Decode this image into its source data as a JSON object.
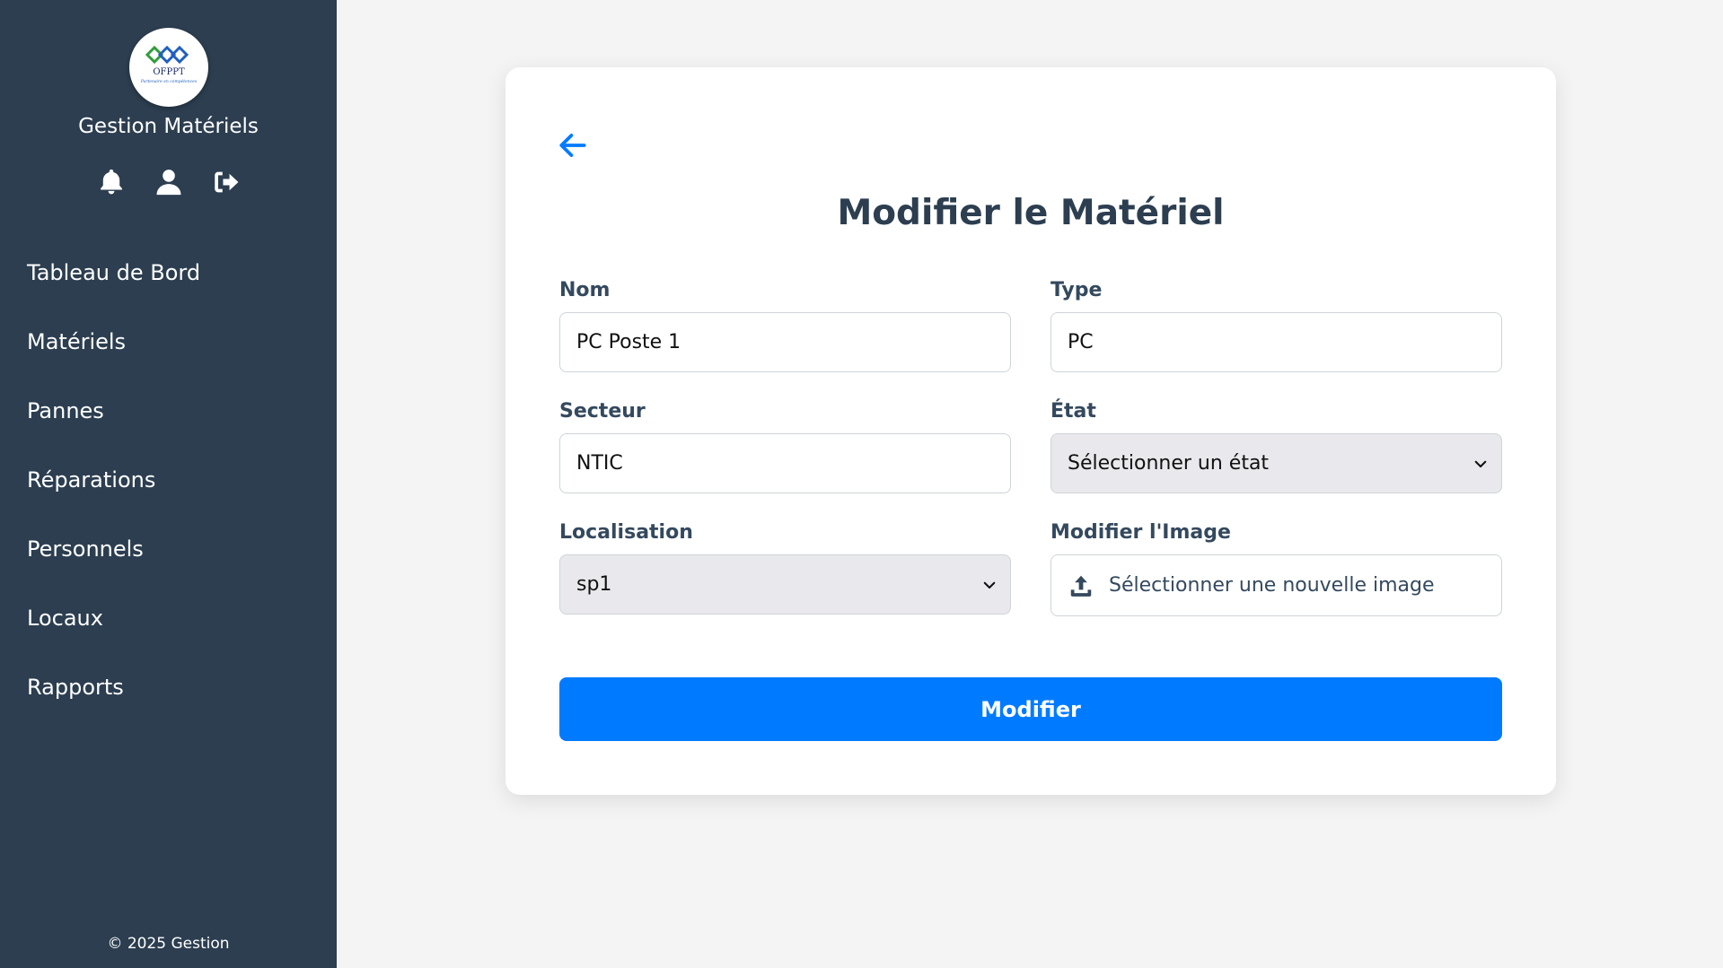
{
  "sidebar": {
    "logo_text": "OFPPT",
    "logo_tagline": "Partenaire en compétences",
    "app_title": "Gestion Matériels",
    "icons": [
      "bell-icon",
      "user-icon",
      "logout-icon"
    ],
    "nav": [
      {
        "label": "Tableau de Bord"
      },
      {
        "label": "Matériels"
      },
      {
        "label": "Pannes"
      },
      {
        "label": "Réparations"
      },
      {
        "label": "Personnels"
      },
      {
        "label": "Locaux"
      },
      {
        "label": "Rapports"
      }
    ],
    "footer": "© 2025 Gestion"
  },
  "form": {
    "back_icon": "arrow-left-icon",
    "title": "Modifier le Matériel",
    "nom": {
      "label": "Nom",
      "value": "PC Poste 1"
    },
    "type": {
      "label": "Type",
      "value": "PC"
    },
    "secteur": {
      "label": "Secteur",
      "value": "NTIC"
    },
    "etat": {
      "label": "État",
      "selected": "Sélectionner un état"
    },
    "localisation": {
      "label": "Localisation",
      "selected": "sp1"
    },
    "image": {
      "label": "Modifier l'Image",
      "button": "Sélectionner une nouvelle image"
    },
    "submit": "Modifier"
  },
  "colors": {
    "sidebar_bg": "#2c3e50",
    "accent": "#007bff",
    "page_bg": "#f4f4f4"
  }
}
